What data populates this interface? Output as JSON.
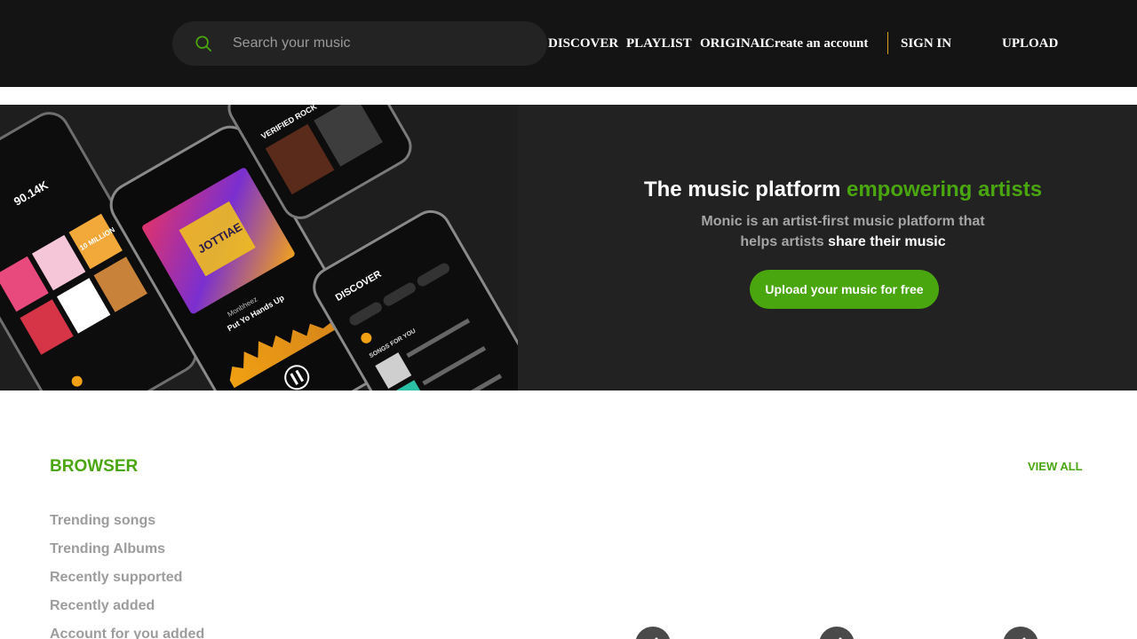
{
  "header": {
    "search": {
      "placeholder": "Search your music",
      "icon": "search-icon"
    },
    "nav": {
      "discover": "DISCOVER",
      "playlist": "PLAYLIST",
      "original": "ORIGINAL",
      "create_account": "Create an account",
      "sign_in": "SIGN IN",
      "upload": "UPLOAD"
    }
  },
  "hero": {
    "title_main": "The music platform ",
    "title_accent": "empowering artists",
    "subtitle_line1": "Monic is an artist-first music platform that",
    "subtitle_line2_prefix": "helps artists ",
    "subtitle_line2_strong": "share their music",
    "cta_label": "Upload your music for free",
    "phone_screen": {
      "discover_label": "DISCOVER",
      "album_title": "JOTTIAE",
      "now_playing_artist": "Monbheez",
      "now_playing_song": "Put Yo Hands Up",
      "songs_for_you": "SONGS FOR YOU",
      "verified_rock": "VERIFIED ROCK",
      "stat_1": "90.14K",
      "stat_2": "10 MILLION"
    }
  },
  "browser": {
    "title": "BROWSER",
    "view_all": "VIEW ALL",
    "items": [
      "Trending songs",
      "Trending Albums",
      "Recently supported",
      "Recently added",
      "Account for you added"
    ]
  },
  "colors": {
    "accent": "#4aa60f",
    "header_bg": "#141414",
    "hero_bg": "#222222",
    "divider": "#d9a21b"
  }
}
